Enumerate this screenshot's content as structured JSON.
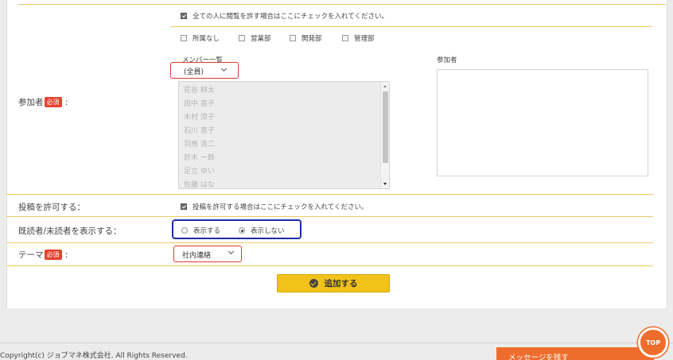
{
  "public_access": {
    "label": "全ての人に閲覧を許す場合はここにチェックを入れてください。",
    "checked": true
  },
  "departments": [
    {
      "label": "所属なし",
      "checked": false
    },
    {
      "label": "営業部",
      "checked": false
    },
    {
      "label": "開発部",
      "checked": false
    },
    {
      "label": "管理部",
      "checked": false
    }
  ],
  "attendees": {
    "label": "参加者",
    "required_badge": "必須",
    "colon": ":",
    "member_list_heading": "メンバー一覧",
    "member_filter_value": "(全員)",
    "members": [
      "花谷 耕太",
      "田中 直子",
      "木村 涼子",
      "石川 恵子",
      "羽鳥 浩二",
      "鈴木 一郎",
      "足立 ゆい",
      "佐藤 はな"
    ],
    "selected_heading": "参加者"
  },
  "allow_posting": {
    "label": "投稿を許可する：",
    "option": "投稿を許可する場合はここにチェックを入れてください。",
    "checked": true
  },
  "show_readers": {
    "label": "既読者/未読者を表示する：",
    "options": [
      "表示する",
      "表示しない"
    ],
    "selected_index": 1
  },
  "theme": {
    "label": "テーマ",
    "required_badge": "必須",
    "colon": ":",
    "value": "社内連絡"
  },
  "submit_label": "追加する",
  "footer": {
    "copyright": "Copyright(c) ジョブマネ株式会社. All Rights Reserved.",
    "message_button": "メッセージを残す",
    "top_button": "TOP"
  },
  "colors": {
    "accent": "#f2c21b",
    "required": "#e8412c",
    "orange": "#ef6d2c",
    "highlight_red": "#e03a2a",
    "highlight_blue": "#1c2aa8"
  }
}
